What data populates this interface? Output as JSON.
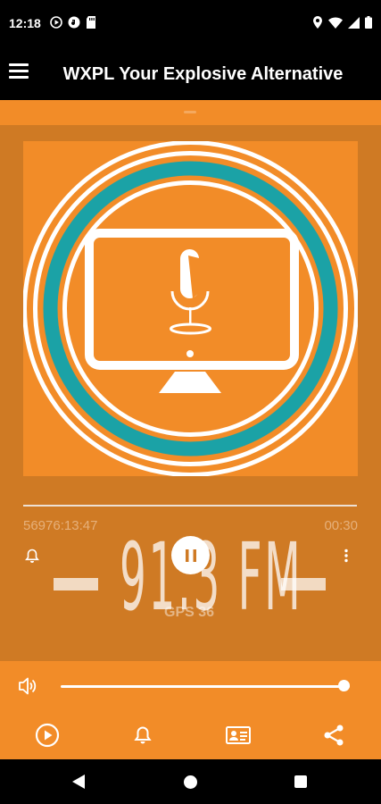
{
  "status_bar": {
    "time": "12:18",
    "left_icons": [
      "play-circle-icon",
      "music-app-icon",
      "sd-card-icon"
    ],
    "right_icons": [
      "location-icon",
      "wifi-icon",
      "signal-icon",
      "battery-icon"
    ]
  },
  "app_bar": {
    "title": "WXPL Your Explosive Alternative",
    "menu_icon": "hamburger-menu-icon"
  },
  "colors": {
    "accent": "#F28C28",
    "player_bg": "#CF7A24",
    "logo_ring": "#1BA2A6",
    "bars": "#000000"
  },
  "player": {
    "elapsed": "56976:13:47",
    "duration": "00:30",
    "frequency_display": "91.3 FM",
    "station_sub": "GPS 36",
    "state_icon": "pause-icon"
  },
  "volume": {
    "level_percent": 100
  },
  "toolbar": {
    "items": [
      "play-circle-icon",
      "alarm-icon",
      "contact-card-icon",
      "share-icon"
    ]
  },
  "nav": {
    "items": [
      "back-icon",
      "home-icon",
      "recents-icon"
    ]
  }
}
